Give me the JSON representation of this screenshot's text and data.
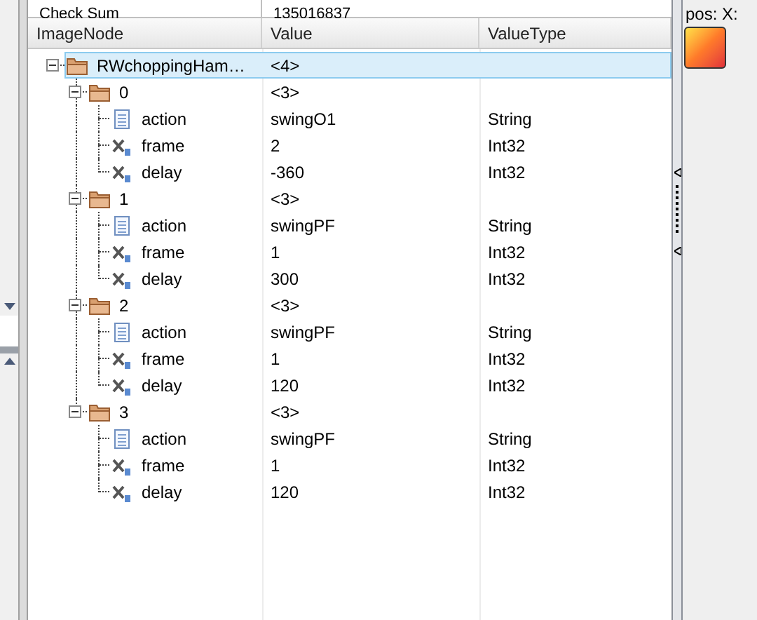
{
  "top_row": {
    "label": "Check Sum",
    "value": "135016837"
  },
  "columns": [
    "ImageNode",
    "Value",
    "ValueType"
  ],
  "tree": [
    {
      "kind": "folder",
      "name": "RWchoppingHam…",
      "value": "<4>",
      "expanded": true,
      "selected": true,
      "children": [
        {
          "kind": "folder",
          "name": "0",
          "value": "<3>",
          "expanded": true,
          "selected": false,
          "children": [
            {
              "kind": "string",
              "name": "action",
              "value": "swingO1",
              "type": "String",
              "selected": false
            },
            {
              "kind": "int",
              "name": "frame",
              "value": "2",
              "type": "Int32",
              "selected": false
            },
            {
              "kind": "int",
              "name": "delay",
              "value": "-360",
              "type": "Int32",
              "selected": false
            }
          ]
        },
        {
          "kind": "folder",
          "name": "1",
          "value": "<3>",
          "expanded": true,
          "selected": false,
          "children": [
            {
              "kind": "string",
              "name": "action",
              "value": "swingPF",
              "type": "String",
              "selected": false
            },
            {
              "kind": "int",
              "name": "frame",
              "value": "1",
              "type": "Int32",
              "selected": false
            },
            {
              "kind": "int",
              "name": "delay",
              "value": "300",
              "type": "Int32",
              "selected": false
            }
          ]
        },
        {
          "kind": "folder",
          "name": "2",
          "value": "<3>",
          "expanded": true,
          "selected": false,
          "children": [
            {
              "kind": "string",
              "name": "action",
              "value": "swingPF",
              "type": "String",
              "selected": false
            },
            {
              "kind": "int",
              "name": "frame",
              "value": "1",
              "type": "Int32",
              "selected": false
            },
            {
              "kind": "int",
              "name": "delay",
              "value": "120",
              "type": "Int32",
              "selected": false
            }
          ]
        },
        {
          "kind": "folder",
          "name": "3",
          "value": "<3>",
          "expanded": true,
          "selected": false,
          "children": [
            {
              "kind": "string",
              "name": "action",
              "value": "swingPF",
              "type": "String",
              "selected": false
            },
            {
              "kind": "int",
              "name": "frame",
              "value": "1",
              "type": "Int32",
              "selected": false
            },
            {
              "kind": "int",
              "name": "delay",
              "value": "120",
              "type": "Int32",
              "selected": false
            }
          ]
        }
      ]
    }
  ],
  "side_panel": {
    "label": "pos:",
    "coords": "X:"
  }
}
